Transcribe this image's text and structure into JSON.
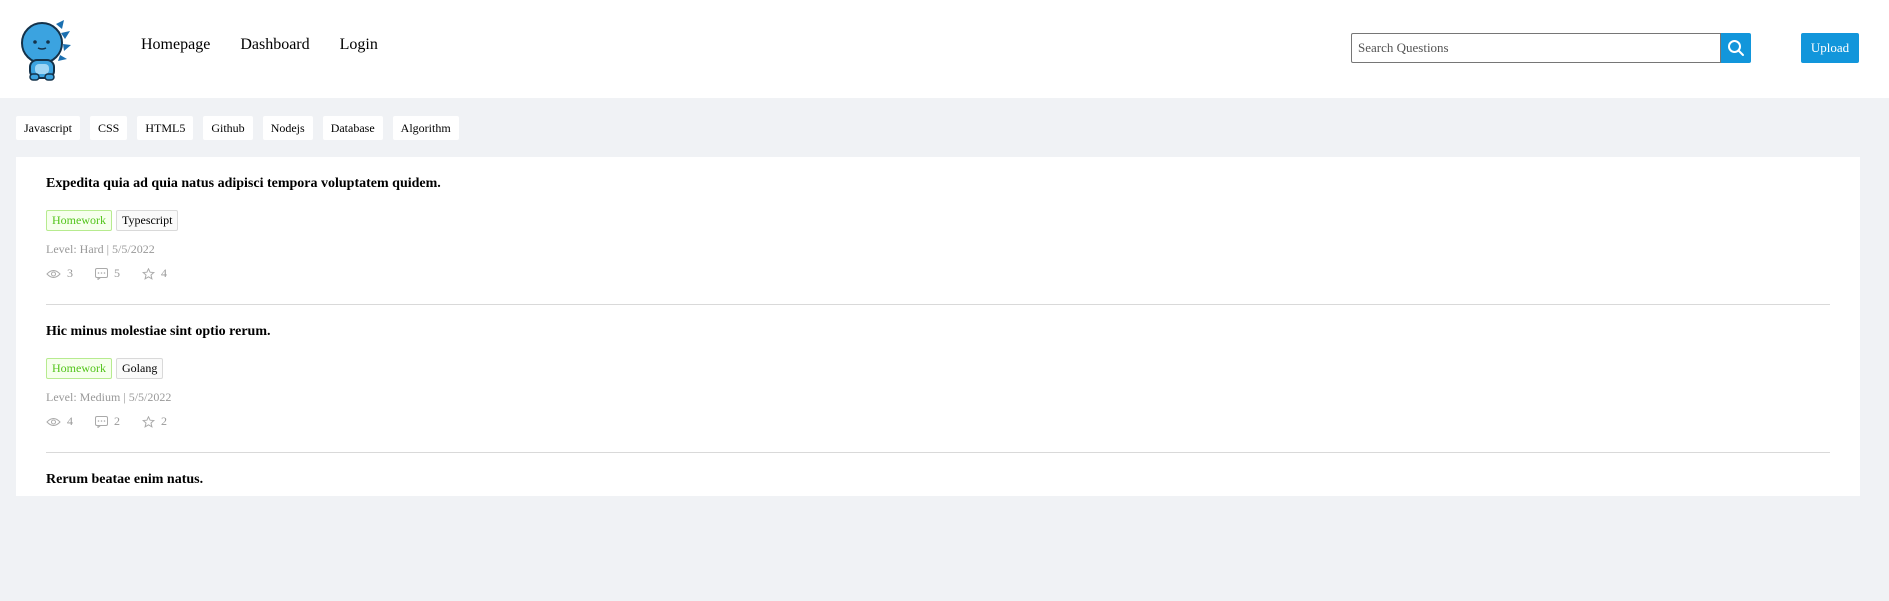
{
  "nav": {
    "items": [
      "Homepage",
      "Dashboard",
      "Login"
    ]
  },
  "search": {
    "placeholder": "Search Questions",
    "value": ""
  },
  "upload_label": "Upload",
  "categories": [
    "Javascript",
    "CSS",
    "HTML5",
    "Github",
    "Nodejs",
    "Database",
    "Algorithm"
  ],
  "questions": [
    {
      "title": "Expedita quia ad quia natus adipisci tempora voluptatem quidem.",
      "tags": [
        "Homework",
        "Typescript"
      ],
      "meta": "Level: Hard | 5/5/2022",
      "views": "3",
      "comments": "5",
      "stars": "4"
    },
    {
      "title": "Hic minus molestiae sint optio rerum.",
      "tags": [
        "Homework",
        "Golang"
      ],
      "meta": "Level: Medium | 5/5/2022",
      "views": "4",
      "comments": "2",
      "stars": "2"
    },
    {
      "title": "Rerum beatae enim natus.",
      "tags": [],
      "meta": "",
      "views": "",
      "comments": "",
      "stars": ""
    }
  ],
  "colors": {
    "accent": "#1296db",
    "background": "#f0f2f5",
    "tag_green_text": "#52c41a",
    "meta_text": "#999999"
  },
  "icons": {
    "logo": "mascot-logo",
    "search": "search-icon",
    "views": "eye-icon",
    "comments": "comment-icon",
    "stars": "star-icon"
  }
}
